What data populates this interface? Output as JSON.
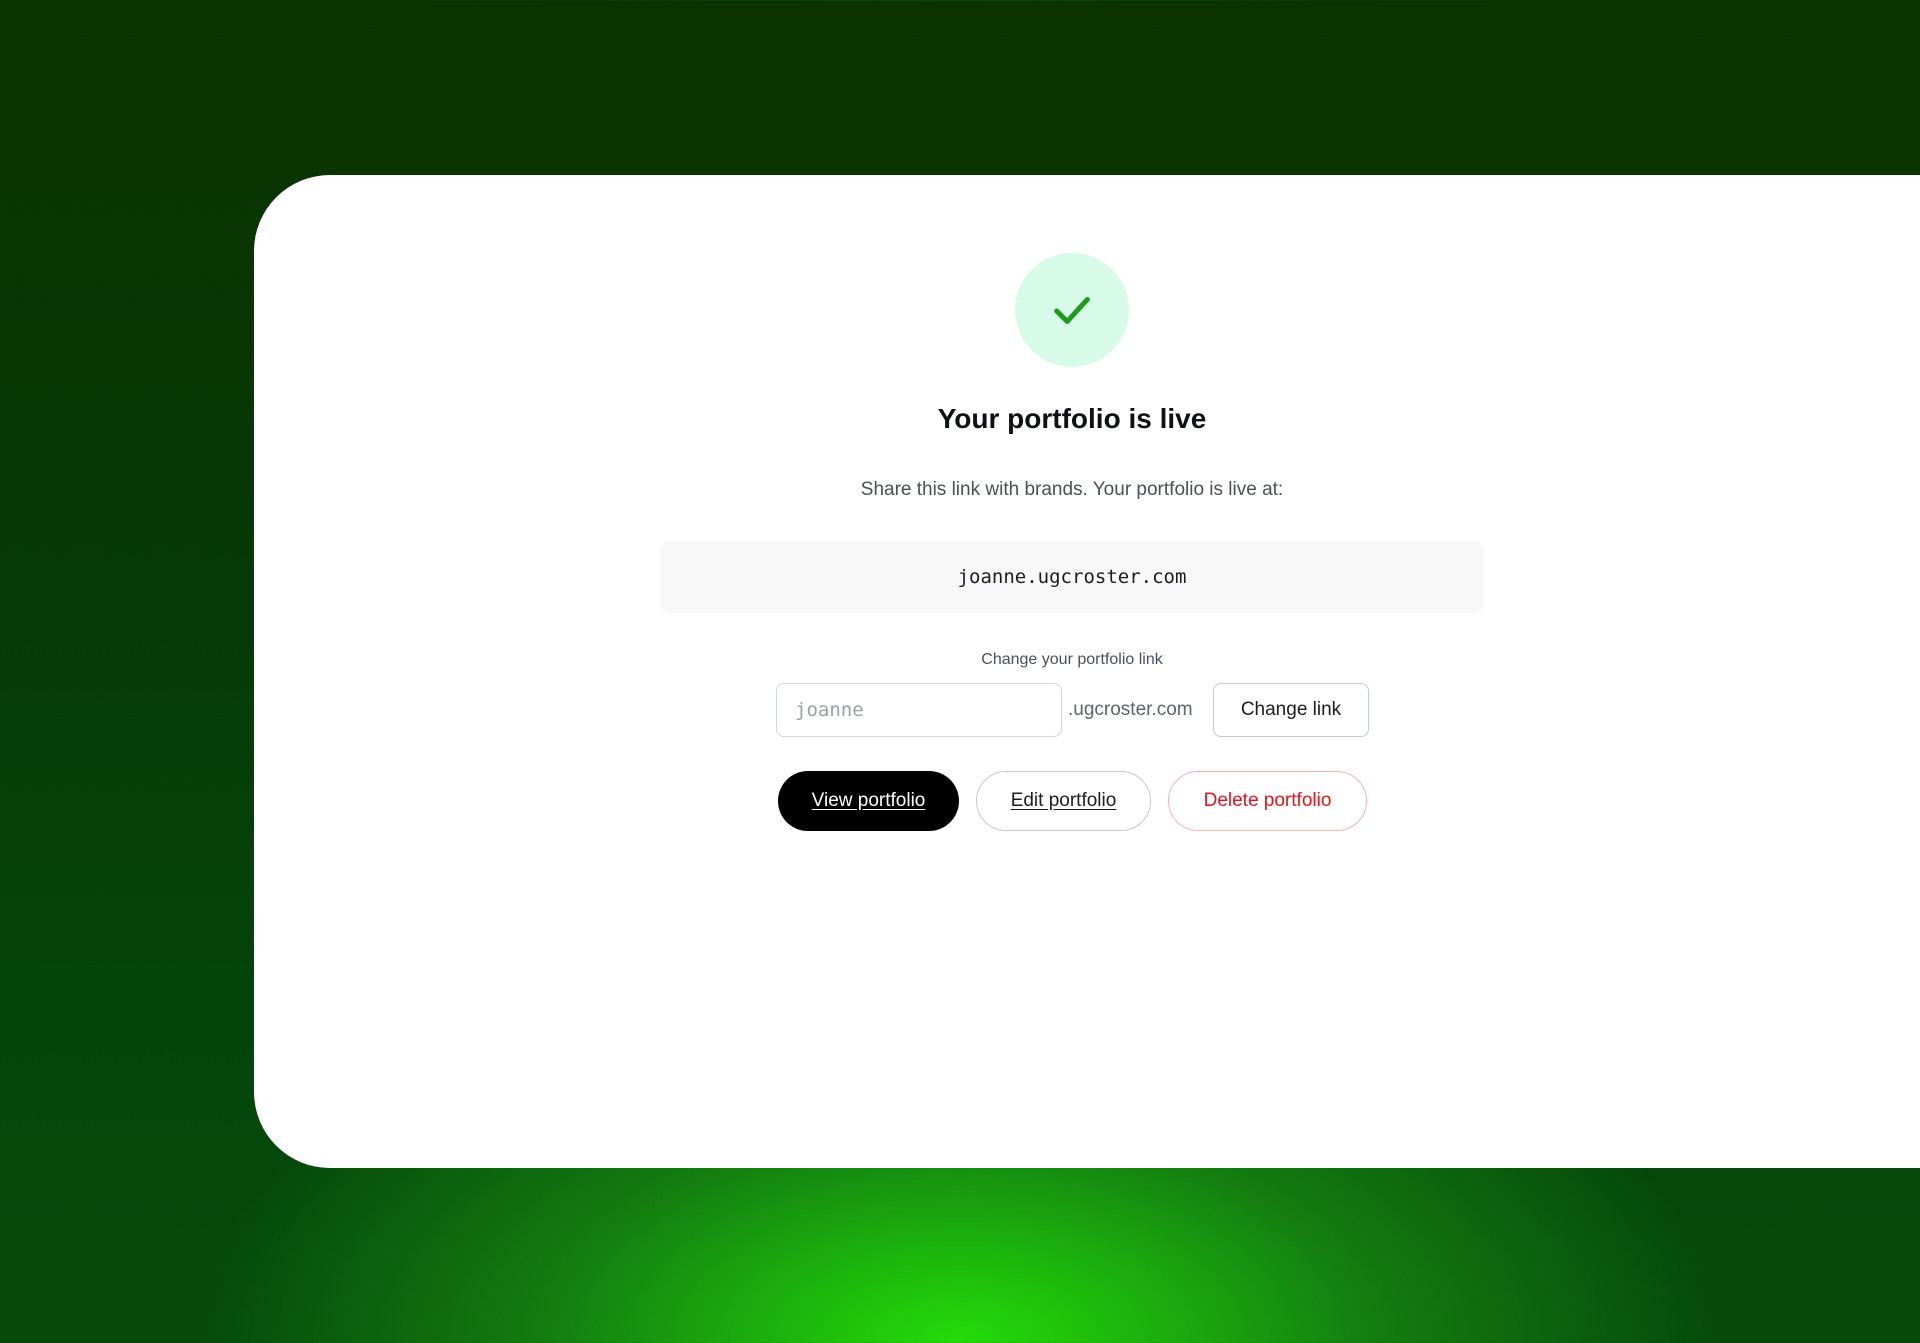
{
  "success": {
    "icon": "check-icon",
    "title": "Your portfolio is live",
    "subtitle": "Share this link with brands. Your portfolio is live at:",
    "url": "joanne.ugcroster.com"
  },
  "change_link": {
    "label": "Change your portfolio link",
    "input_placeholder": "joanne",
    "input_value": "",
    "domain_suffix": ".ugcroster.com",
    "button_label": "Change link"
  },
  "actions": {
    "view_label": "View portfolio",
    "edit_label": "Edit portfolio",
    "delete_label": "Delete portfolio"
  },
  "colors": {
    "success_bg": "#d7fbe8",
    "success_check": "#1e9b1a",
    "primary": "#000000",
    "danger": "#e8121c",
    "danger_border": "#f3b4b8"
  }
}
